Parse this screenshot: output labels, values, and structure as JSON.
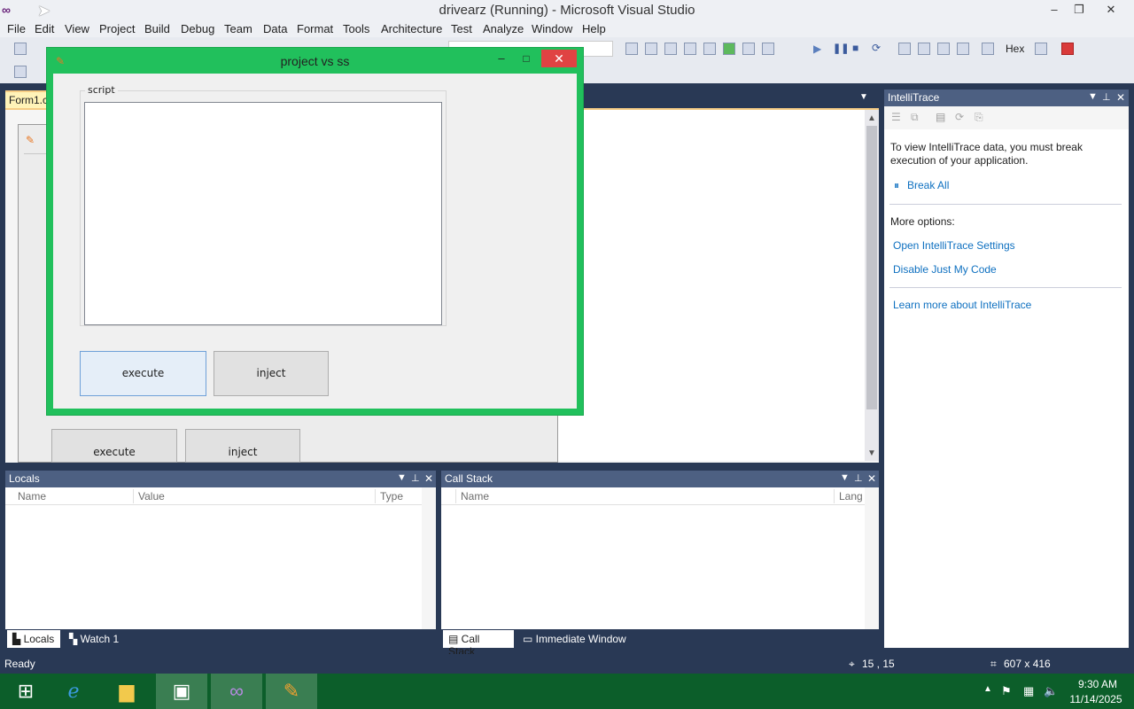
{
  "window": {
    "title": "drivearz (Running) - Microsoft Visual Studio",
    "minimize": "–",
    "restore": "❐",
    "close": "✕"
  },
  "menu": [
    "File",
    "Edit",
    "View",
    "Project",
    "Build",
    "Debug",
    "Team",
    "Data",
    "Format",
    "Tools",
    "Architecture",
    "Test",
    "Analyze",
    "Window",
    "Help"
  ],
  "toolbar": {
    "hex_label": "Hex"
  },
  "document": {
    "tab_label": "Form1.c",
    "background_buttons": {
      "execute": "execute",
      "inject": "inject"
    }
  },
  "app_window": {
    "title": "project vs ss",
    "group_label": "script",
    "execute_label": "execute",
    "inject_label": "inject",
    "close": "✕",
    "min": "–",
    "max": "□"
  },
  "intellitrace": {
    "title": "IntelliTrace",
    "message": "To view IntelliTrace data, you must break execution of your application.",
    "break_all": "Break All",
    "more_options": "More options:",
    "open_settings": "Open IntelliTrace Settings",
    "disable_jmc": "Disable Just My Code",
    "learn_more": "Learn more about IntelliTrace"
  },
  "locals": {
    "title": "Locals",
    "columns": [
      "Name",
      "Value",
      "Type"
    ],
    "tabs": [
      "Locals",
      "Watch 1"
    ]
  },
  "callstack": {
    "title": "Call Stack",
    "columns": [
      "Name",
      "Lang"
    ],
    "tabs": [
      "Call Stack",
      "Immediate Window"
    ]
  },
  "status": {
    "ready": "Ready",
    "position": "15 , 15",
    "size": "607 x 416"
  },
  "taskbar": {
    "time": "9:30 AM",
    "date": "11/14/2025"
  }
}
